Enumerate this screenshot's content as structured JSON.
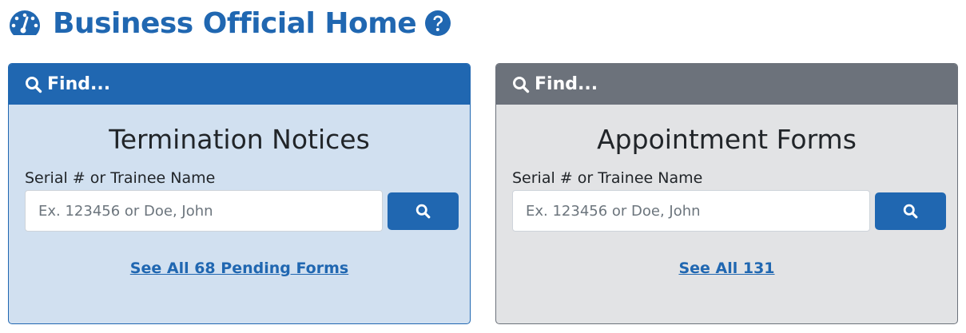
{
  "header": {
    "title": "Business Official Home",
    "icon": "dashboard-icon",
    "help_icon": "question-circle-icon"
  },
  "colors": {
    "primary": "#2067b1",
    "secondary": "#6c727b",
    "primary_panel_bg": "#d1e0f0",
    "secondary_panel_bg": "#e2e3e5"
  },
  "panels": [
    {
      "header_label": "Find...",
      "title": "Termination Notices",
      "field_label": "Serial # or Trainee Name",
      "placeholder": "Ex. 123456 or Doe, John",
      "input_value": "",
      "see_all_label": "See All 68 Pending Forms"
    },
    {
      "header_label": "Find...",
      "title": "Appointment Forms",
      "field_label": "Serial # or Trainee Name",
      "placeholder": "Ex. 123456 or Doe, John",
      "input_value": "",
      "see_all_label": "See All 131"
    }
  ]
}
